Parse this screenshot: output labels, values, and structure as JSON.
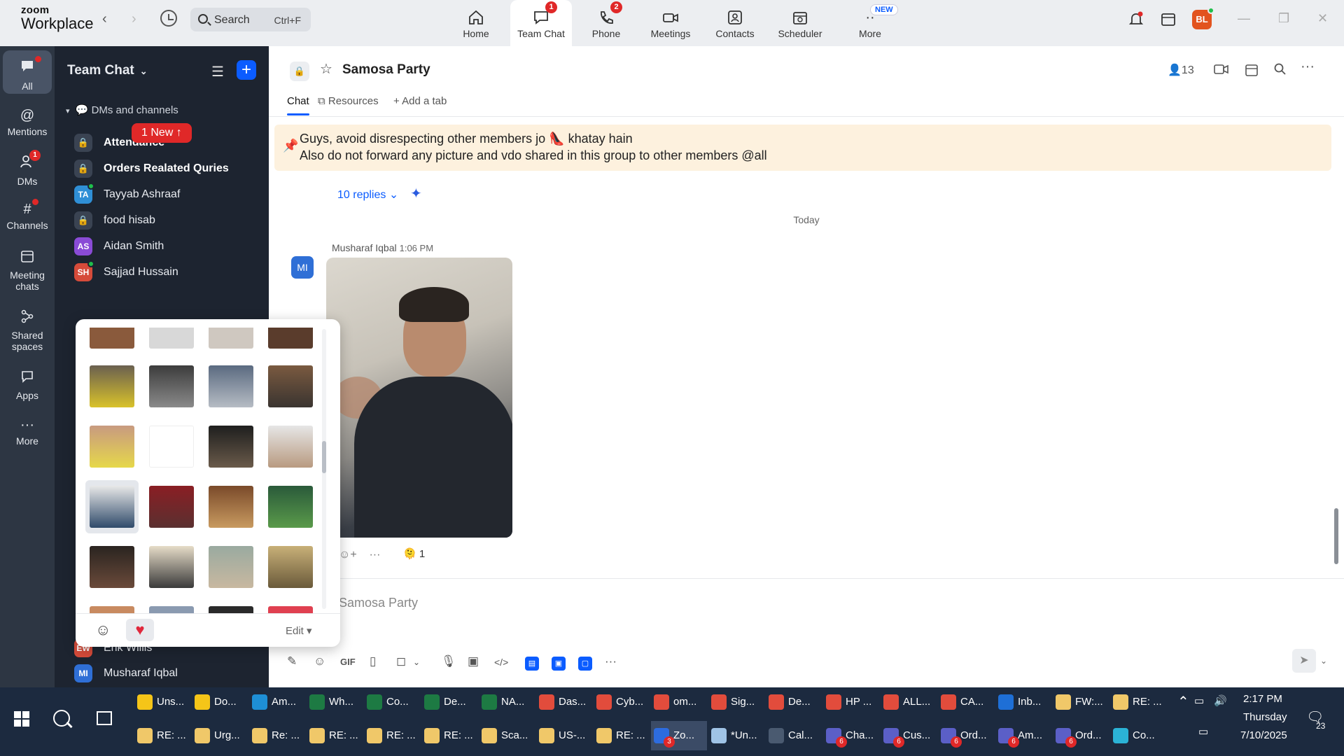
{
  "app": {
    "logo_top": "zoom",
    "logo_bottom": "Workplace",
    "search_label": "Search",
    "search_shortcut": "Ctrl+F",
    "avatar_initials": "BL"
  },
  "nav_tabs": [
    {
      "label": "Home",
      "icon": "home-icon",
      "badge": ""
    },
    {
      "label": "Team Chat",
      "icon": "chat-icon",
      "badge": "1"
    },
    {
      "label": "Phone",
      "icon": "phone-icon",
      "badge": "2"
    },
    {
      "label": "Meetings",
      "icon": "video-icon",
      "badge": ""
    },
    {
      "label": "Contacts",
      "icon": "contacts-icon",
      "badge": ""
    },
    {
      "label": "Scheduler",
      "icon": "calendar-icon",
      "badge": ""
    },
    {
      "label": "More",
      "icon": "more-icon",
      "badge": "NEW"
    }
  ],
  "rail": [
    {
      "label": "All",
      "icon": "chat-bubble-icon"
    },
    {
      "label": "Mentions",
      "icon": "at-icon"
    },
    {
      "label": "DMs",
      "icon": "people-icon",
      "badge": "1"
    },
    {
      "label": "Channels",
      "icon": "hash-icon"
    },
    {
      "label": "Meeting chats",
      "icon": "calendar-icon"
    },
    {
      "label": "Shared spaces",
      "icon": "share-icon"
    },
    {
      "label": "Apps",
      "icon": "apps-icon"
    },
    {
      "label": "More",
      "icon": "more-icon"
    }
  ],
  "sidebar": {
    "title": "Team Chat",
    "section": "DMs and channels",
    "new_pill": "1 New ↑",
    "items": [
      {
        "label": "Attendance",
        "avatar": "",
        "bold": true,
        "color": "#3a4352"
      },
      {
        "label": "Orders Realated Quries",
        "avatar": "",
        "bold": true,
        "color": "#3a4352"
      },
      {
        "label": "Tayyab Ashraaf",
        "avatar": "TA",
        "bold": false,
        "color": "#2f8fd6"
      },
      {
        "label": "food hisab",
        "avatar": "",
        "bold": false,
        "color": "#3a4352"
      },
      {
        "label": "Aidan Smith",
        "avatar": "AS",
        "bold": false,
        "color": "#8a4bd6"
      },
      {
        "label": "Sajjad Hussain",
        "avatar": "SH",
        "bold": false,
        "color": "#d64b3a"
      }
    ],
    "bottom_items": [
      {
        "label": "Erik Willis",
        "avatar": "EW",
        "color": "#d64b3a"
      },
      {
        "label": "Musharaf Iqbal",
        "avatar": "MI",
        "color": "#2f6fd6"
      }
    ]
  },
  "sticker_picker": {
    "edit_label": "Edit ▾"
  },
  "chat": {
    "title": "Samosa Party",
    "members": "13",
    "tabs": [
      "Chat",
      "Resources",
      "Add a tab"
    ],
    "pinned_line1": "Guys, avoid disrespecting other members jo 👠 khatay hain",
    "pinned_line2": "Also do not forward any picture and vdo shared in this group to other members @all",
    "replies": "10 replies",
    "date_divider": "Today",
    "message": {
      "avatar": "MI",
      "sender": "Musharaf Iqbal",
      "time": "1:06 PM",
      "reaction_count": "1"
    },
    "composer_placeholder": "Samosa Party"
  },
  "taskbar": {
    "row1": [
      {
        "label": "Uns...",
        "color": "#f5c518"
      },
      {
        "label": "Do...",
        "color": "#f5c518"
      },
      {
        "label": "Am...",
        "color": "#1e8fd6"
      },
      {
        "label": "Wh...",
        "color": "#1d7a43"
      },
      {
        "label": "Co...",
        "color": "#1d7a43"
      },
      {
        "label": "De...",
        "color": "#1d7a43"
      },
      {
        "label": "NA...",
        "color": "#1d7a43"
      },
      {
        "label": "Das...",
        "color": "#e24c3c"
      },
      {
        "label": "Cyb...",
        "color": "#e24c3c"
      },
      {
        "label": "om...",
        "color": "#e24c3c"
      },
      {
        "label": "Sig...",
        "color": "#e24c3c"
      },
      {
        "label": "De...",
        "color": "#e24c3c"
      },
      {
        "label": "HP ...",
        "color": "#e24c3c"
      },
      {
        "label": "ALL...",
        "color": "#e24c3c"
      },
      {
        "label": "CA...",
        "color": "#e24c3c"
      },
      {
        "label": "Inb...",
        "color": "#1e6fd6"
      },
      {
        "label": "FW:...",
        "color": "#f0c869"
      },
      {
        "label": "RE: ...",
        "color": "#f0c869"
      }
    ],
    "row2": [
      {
        "label": "RE: ...",
        "color": "#f0c869"
      },
      {
        "label": "Urg...",
        "color": "#f0c869"
      },
      {
        "label": "Re: ...",
        "color": "#f0c869"
      },
      {
        "label": "RE: ...",
        "color": "#f0c869"
      },
      {
        "label": "RE: ...",
        "color": "#f0c869"
      },
      {
        "label": "RE: ...",
        "color": "#f0c869"
      },
      {
        "label": "Sca...",
        "color": "#f0c869"
      },
      {
        "label": "US-...",
        "color": "#f0c869"
      },
      {
        "label": "RE: ...",
        "color": "#f0c869"
      },
      {
        "label": "Zo...",
        "color": "#2d6cdf",
        "badge": "3"
      },
      {
        "label": "*Un...",
        "color": "#9fc3e6"
      },
      {
        "label": "Cal...",
        "color": "#4a5a70"
      },
      {
        "label": "Cha...",
        "color": "#5b5fc7",
        "badge": "6"
      },
      {
        "label": "Cus...",
        "color": "#5b5fc7",
        "badge": "6"
      },
      {
        "label": "Ord...",
        "color": "#5b5fc7",
        "badge": "6"
      },
      {
        "label": "Am...",
        "color": "#5b5fc7",
        "badge": "6"
      },
      {
        "label": "Ord...",
        "color": "#5b5fc7",
        "badge": "6"
      },
      {
        "label": "Co...",
        "color": "#2bb3d6"
      }
    ],
    "time": "2:17 PM",
    "day": "Thursday",
    "date": "7/10/2025",
    "notif_count": "23"
  },
  "colors": {
    "accent": "#0b5cff",
    "badge": "#e02828",
    "sidebar_bg": "#1d2430",
    "rail_bg": "#2d3643",
    "pinned_bg": "#fdf1de"
  }
}
